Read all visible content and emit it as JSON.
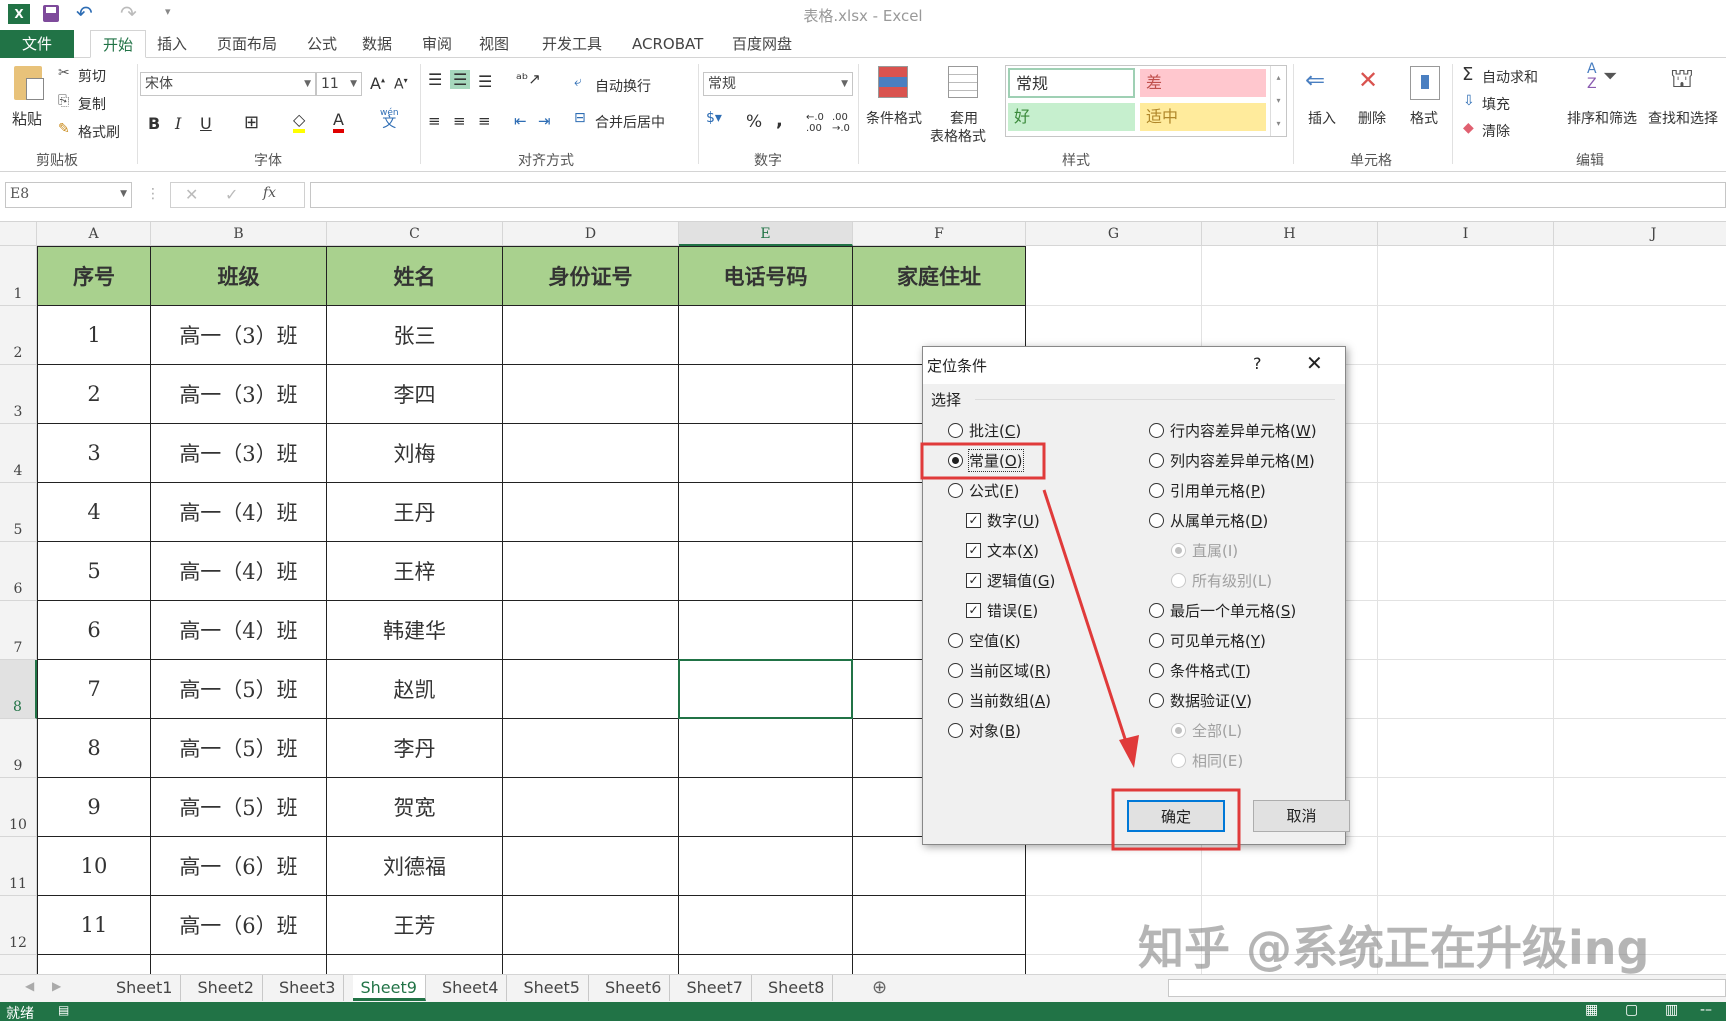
{
  "window": {
    "title": "表格.xlsx - Excel"
  },
  "quick_access": {
    "icons": [
      "excel-logo",
      "save",
      "undo",
      "redo",
      "customize"
    ]
  },
  "menu_tabs": [
    "文件",
    "开始",
    "插入",
    "页面布局",
    "公式",
    "数据",
    "审阅",
    "视图",
    "开发工具",
    "ACROBAT",
    "百度网盘"
  ],
  "active_tab": "开始",
  "ribbon": {
    "clipboard": {
      "paste": "粘贴",
      "cut": "剪切",
      "copy": "复制",
      "format_painter": "格式刷",
      "label": "剪贴板"
    },
    "font": {
      "name": "宋体",
      "size": "11",
      "bold": "B",
      "italic": "I",
      "underline": "U",
      "phonetic": "wén",
      "label": "字体"
    },
    "alignment": {
      "wrap": "自动换行",
      "merge": "合并后居中",
      "label": "对齐方式"
    },
    "number": {
      "format": "常规",
      "percent": "%",
      "comma": ",",
      "label": "数字"
    },
    "styles": {
      "conditional": "条件格式",
      "table_format_1": "套用",
      "table_format_2": "表格格式",
      "normal": "常规",
      "bad": "差",
      "good": "好",
      "neutral": "适中",
      "label": "样式"
    },
    "cells": {
      "insert": "插入",
      "delete": "删除",
      "format": "格式",
      "label": "单元格"
    },
    "editing": {
      "autosum": "自动求和",
      "fill": "填充",
      "clear": "清除",
      "sort": "排序和筛选",
      "find": "查找和选择",
      "label": "编辑"
    },
    "colors": {
      "good_bg": "#c6efce",
      "bad_bg": "#ffc7ce",
      "neutral_bg": "#ffeb9c"
    }
  },
  "formula_bar": {
    "name_box": "E8",
    "fx": "fx",
    "value": ""
  },
  "columns": [
    "A",
    "B",
    "C",
    "D",
    "E",
    "F",
    "G",
    "H",
    "I",
    "J"
  ],
  "table": {
    "headers": [
      "序号",
      "班级",
      "姓名",
      "身份证号",
      "电话号码",
      "家庭住址"
    ],
    "rows": [
      [
        "1",
        "高一（3）班",
        "张三",
        "",
        "",
        ""
      ],
      [
        "2",
        "高一（3）班",
        "李四",
        "",
        "",
        ""
      ],
      [
        "3",
        "高一（3）班",
        "刘梅",
        "",
        "",
        ""
      ],
      [
        "4",
        "高一（4）班",
        "王丹",
        "",
        "",
        ""
      ],
      [
        "5",
        "高一（4）班",
        "王梓",
        "",
        "",
        ""
      ],
      [
        "6",
        "高一（4）班",
        "韩建华",
        "",
        "",
        ""
      ],
      [
        "7",
        "高一（5）班",
        "赵凯",
        "",
        "",
        ""
      ],
      [
        "8",
        "高一（5）班",
        "李丹",
        "",
        "",
        ""
      ],
      [
        "9",
        "高一（5）班",
        "贺宽",
        "",
        "",
        ""
      ],
      [
        "10",
        "高一（6）班",
        "刘德福",
        "",
        "",
        ""
      ],
      [
        "11",
        "高一（6）班",
        "王芳",
        "",
        "",
        ""
      ]
    ],
    "header_color": "#a9d18e"
  },
  "selected_cell": "E8",
  "sheets": [
    "Sheet1",
    "Sheet2",
    "Sheet3",
    "Sheet9",
    "Sheet4",
    "Sheet5",
    "Sheet6",
    "Sheet7",
    "Sheet8"
  ],
  "active_sheet": "Sheet9",
  "status": {
    "text": "就绪"
  },
  "dialog": {
    "title": "定位条件",
    "help": "?",
    "group": "选择",
    "left": [
      {
        "type": "radio",
        "label": "批注(",
        "key": "C",
        "end": ")",
        "checked": false
      },
      {
        "type": "radio",
        "label": "常量(",
        "key": "O",
        "end": ")",
        "checked": true
      },
      {
        "type": "radio",
        "label": "公式(",
        "key": "F",
        "end": ")",
        "checked": false
      },
      {
        "type": "check",
        "label": "数字(",
        "key": "U",
        "end": ")",
        "checked": true
      },
      {
        "type": "check",
        "label": "文本(",
        "key": "X",
        "end": ")",
        "checked": true
      },
      {
        "type": "check",
        "label": "逻辑值(",
        "key": "G",
        "end": ")",
        "checked": true
      },
      {
        "type": "check",
        "label": "错误(",
        "key": "E",
        "end": ")",
        "checked": true
      },
      {
        "type": "radio",
        "label": "空值(",
        "key": "K",
        "end": ")",
        "checked": false
      },
      {
        "type": "radio",
        "label": "当前区域(",
        "key": "R",
        "end": ")",
        "checked": false
      },
      {
        "type": "radio",
        "label": "当前数组(",
        "key": "A",
        "end": ")",
        "checked": false
      },
      {
        "type": "radio",
        "label": "对象(",
        "key": "B",
        "end": ")",
        "checked": false
      }
    ],
    "right": [
      {
        "type": "radio",
        "label": "行内容差异单元格(",
        "key": "W",
        "end": ")",
        "checked": false
      },
      {
        "type": "radio",
        "label": "列内容差异单元格(",
        "key": "M",
        "end": ")",
        "checked": false
      },
      {
        "type": "radio",
        "label": "引用单元格(",
        "key": "P",
        "end": ")",
        "checked": false
      },
      {
        "type": "radio",
        "label": "从属单元格(",
        "key": "D",
        "end": ")",
        "checked": false
      },
      {
        "type": "subradio",
        "label": "直属(I)",
        "checked": true,
        "disabled": true
      },
      {
        "type": "subradio",
        "label": "所有级别(L)",
        "checked": false,
        "disabled": true
      },
      {
        "type": "radio",
        "label": "最后一个单元格(",
        "key": "S",
        "end": ")",
        "checked": false
      },
      {
        "type": "radio",
        "label": "可见单元格(",
        "key": "Y",
        "end": ")",
        "checked": false
      },
      {
        "type": "radio",
        "label": "条件格式(",
        "key": "T",
        "end": ")",
        "checked": false
      },
      {
        "type": "radio",
        "label": "数据验证(",
        "key": "V",
        "end": ")",
        "checked": false
      },
      {
        "type": "subradio",
        "label": "全部(L)",
        "checked": true,
        "disabled": true
      },
      {
        "type": "subradio",
        "label": "相同(E)",
        "checked": false,
        "disabled": true
      }
    ],
    "ok": "确定",
    "cancel": "取消",
    "annotation_color": "#e03a3a"
  },
  "watermark": "知乎 @系统正在升级ing"
}
